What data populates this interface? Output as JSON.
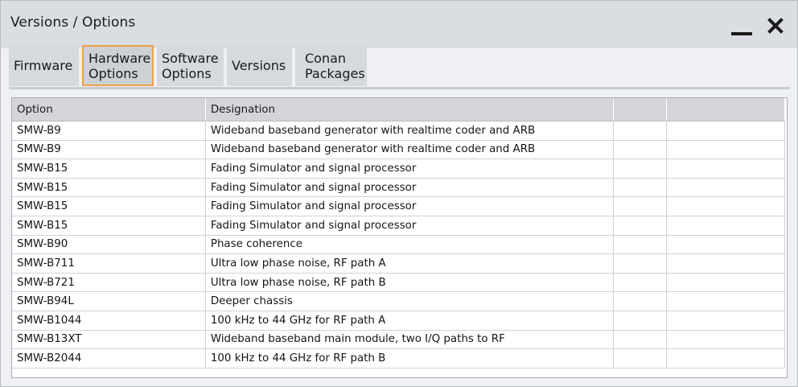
{
  "window": {
    "title": "Versions / Options"
  },
  "tabs": [
    {
      "label": "Firmware",
      "active": false
    },
    {
      "label": "Hardware\nOptions",
      "active": true
    },
    {
      "label": "Software\nOptions",
      "active": false
    },
    {
      "label": "Versions",
      "active": false
    },
    {
      "label": "Conan\nPackages",
      "active": false
    }
  ],
  "table": {
    "columns": [
      "Option",
      "Designation",
      "",
      ""
    ],
    "rows": [
      [
        "SMW-B9",
        "Wideband baseband generator with realtime coder and ARB"
      ],
      [
        "SMW-B9",
        "Wideband baseband generator with realtime coder and ARB"
      ],
      [
        "SMW-B15",
        "Fading Simulator and signal processor"
      ],
      [
        "SMW-B15",
        "Fading Simulator and signal processor"
      ],
      [
        "SMW-B15",
        "Fading Simulator and signal processor"
      ],
      [
        "SMW-B15",
        "Fading Simulator and signal processor"
      ],
      [
        "SMW-B90",
        "Phase coherence"
      ],
      [
        "SMW-B711",
        "Ultra low phase noise, RF path A"
      ],
      [
        "SMW-B721",
        "Ultra low phase noise, RF path B"
      ],
      [
        "SMW-B94L",
        "Deeper chassis"
      ],
      [
        "SMW-B1044",
        "100 kHz to 44 GHz for RF path A"
      ],
      [
        "SMW-B13XT",
        "Wideband baseband main module, two I/Q paths to RF"
      ],
      [
        "SMW-B2044",
        "100 kHz to 44 GHz for RF path B"
      ]
    ]
  },
  "colors": {
    "active_tab_border": "#f0a048",
    "titlebar": "#dadde2",
    "header": "#d3d5d9"
  },
  "icons": {
    "minimize": "minimize-icon",
    "close": "close-icon"
  }
}
